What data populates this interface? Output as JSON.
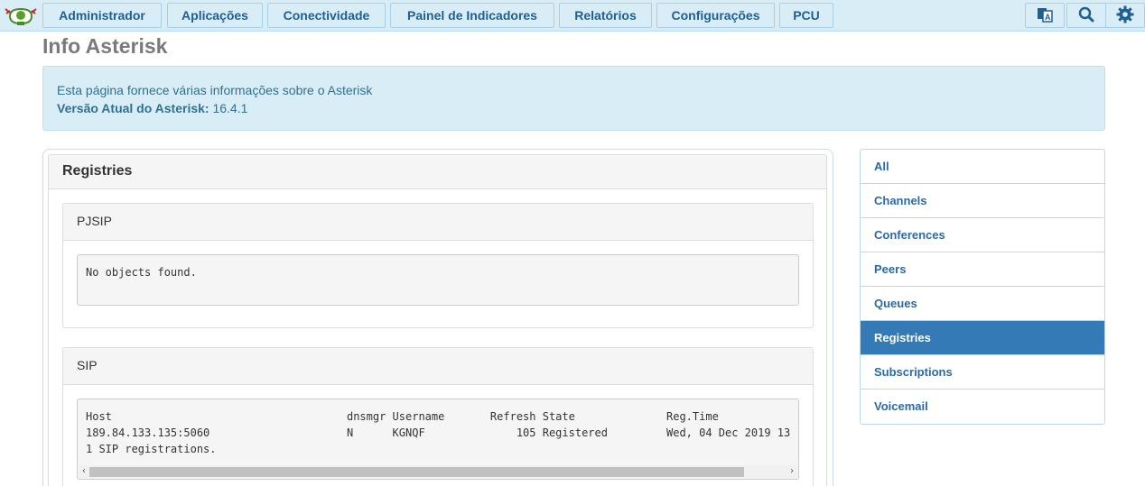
{
  "nav": {
    "items": [
      "Administrador",
      "Aplicações",
      "Conectividade",
      "Painel de Indicadores",
      "Relatórios",
      "Configurações",
      "PCU"
    ],
    "icons": [
      "language-icon",
      "search-icon",
      "gear-icon"
    ]
  },
  "page": {
    "title": "Info Asterisk"
  },
  "info": {
    "description": "Esta página fornece várias informações sobre o Asterisk",
    "version_label": "Versão Atual do Asterisk:",
    "version_value": "16.4.1"
  },
  "registries": {
    "title": "Registries",
    "pjsip": {
      "title": "PJSIP",
      "output": "No objects found."
    },
    "sip": {
      "title": "SIP",
      "lines": [
        "Host                                    dnsmgr Username       Refresh State              Reg.Time",
        "189.84.133.135:5060                     N      KGNQF              105 Registered         Wed, 04 Dec 2019 13",
        "1 SIP registrations."
      ]
    }
  },
  "sidebar": {
    "items": [
      "All",
      "Channels",
      "Conferences",
      "Peers",
      "Queues",
      "Registries",
      "Subscriptions",
      "Voicemail"
    ],
    "active": "Registries"
  },
  "colors": {
    "nav_bg": "#d9edf7",
    "nav_text": "#1e5f94",
    "active_bg": "#337ab7",
    "info_text": "#31708f"
  }
}
